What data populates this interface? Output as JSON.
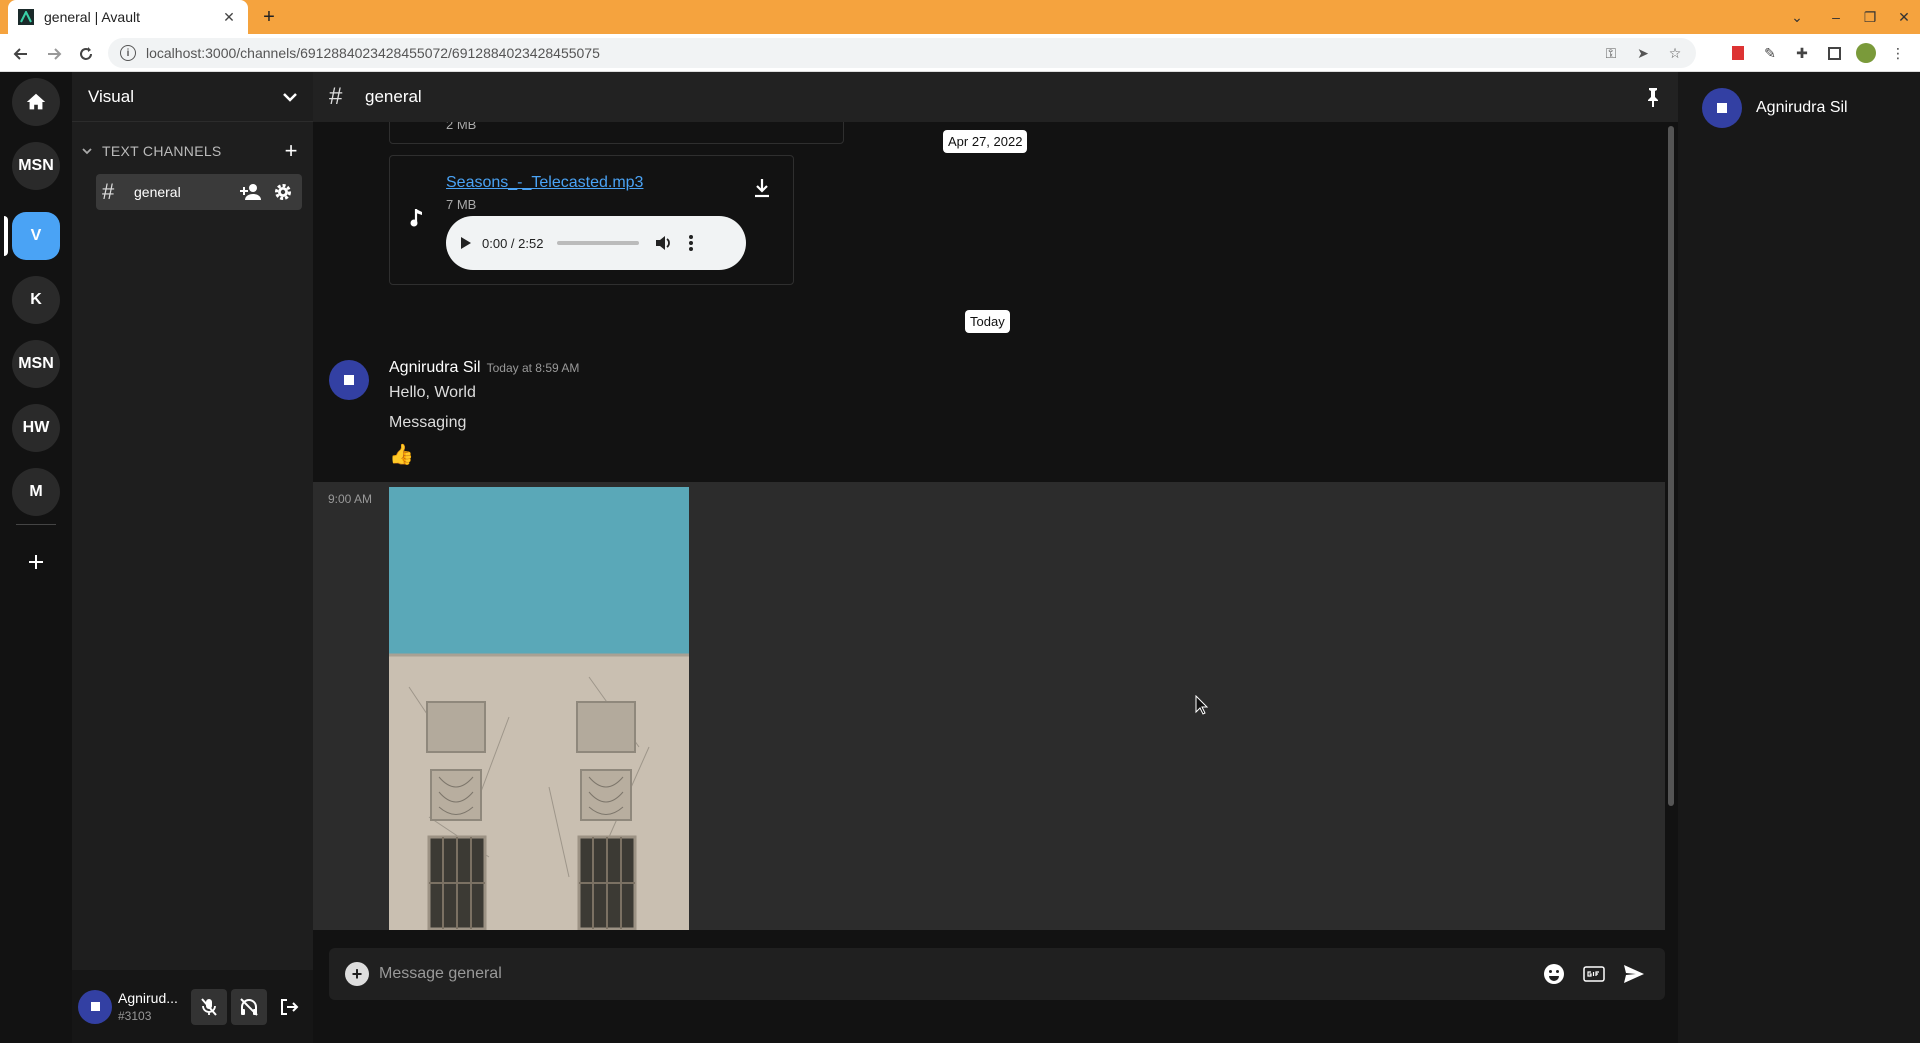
{
  "browser": {
    "tab_title": "general | Avault",
    "url": "localhost:3000/channels/691288402342845507​2/691288402342845507​5"
  },
  "servers": {
    "items": [
      {
        "label": "MSN"
      },
      {
        "label": "V"
      },
      {
        "label": "K"
      },
      {
        "label": "MSN"
      },
      {
        "label": "HW"
      },
      {
        "label": "M"
      }
    ]
  },
  "sidebar": {
    "server_name": "Visual",
    "category_label": "TEXT CHANNELS",
    "channel_name": "general"
  },
  "user": {
    "name": "Agnirud...",
    "discriminator": "#3103"
  },
  "channel": {
    "name": "general"
  },
  "messages": {
    "prev_attachment_size": "2 MB",
    "date_label_1": "Apr 27, 2022",
    "audio": {
      "filename": "Seasons_-_Telecasted.mp3",
      "size": "7 MB",
      "time": "0:00 / 2:52"
    },
    "date_label_2": "Today",
    "author": "Agnirudra Sil",
    "timestamp": "Today at 8:59 AM",
    "lines": [
      "Hello, World",
      "Messaging"
    ],
    "emoji": "👍",
    "followup_time": "9:00 AM"
  },
  "composer": {
    "placeholder": "Message general"
  },
  "members": {
    "items": [
      {
        "name": "Agnirudra Sil"
      }
    ]
  },
  "colors": {
    "accent": "#4aa3f5",
    "avatar": "#3340a3",
    "browser_frame": "#f5a33e"
  }
}
